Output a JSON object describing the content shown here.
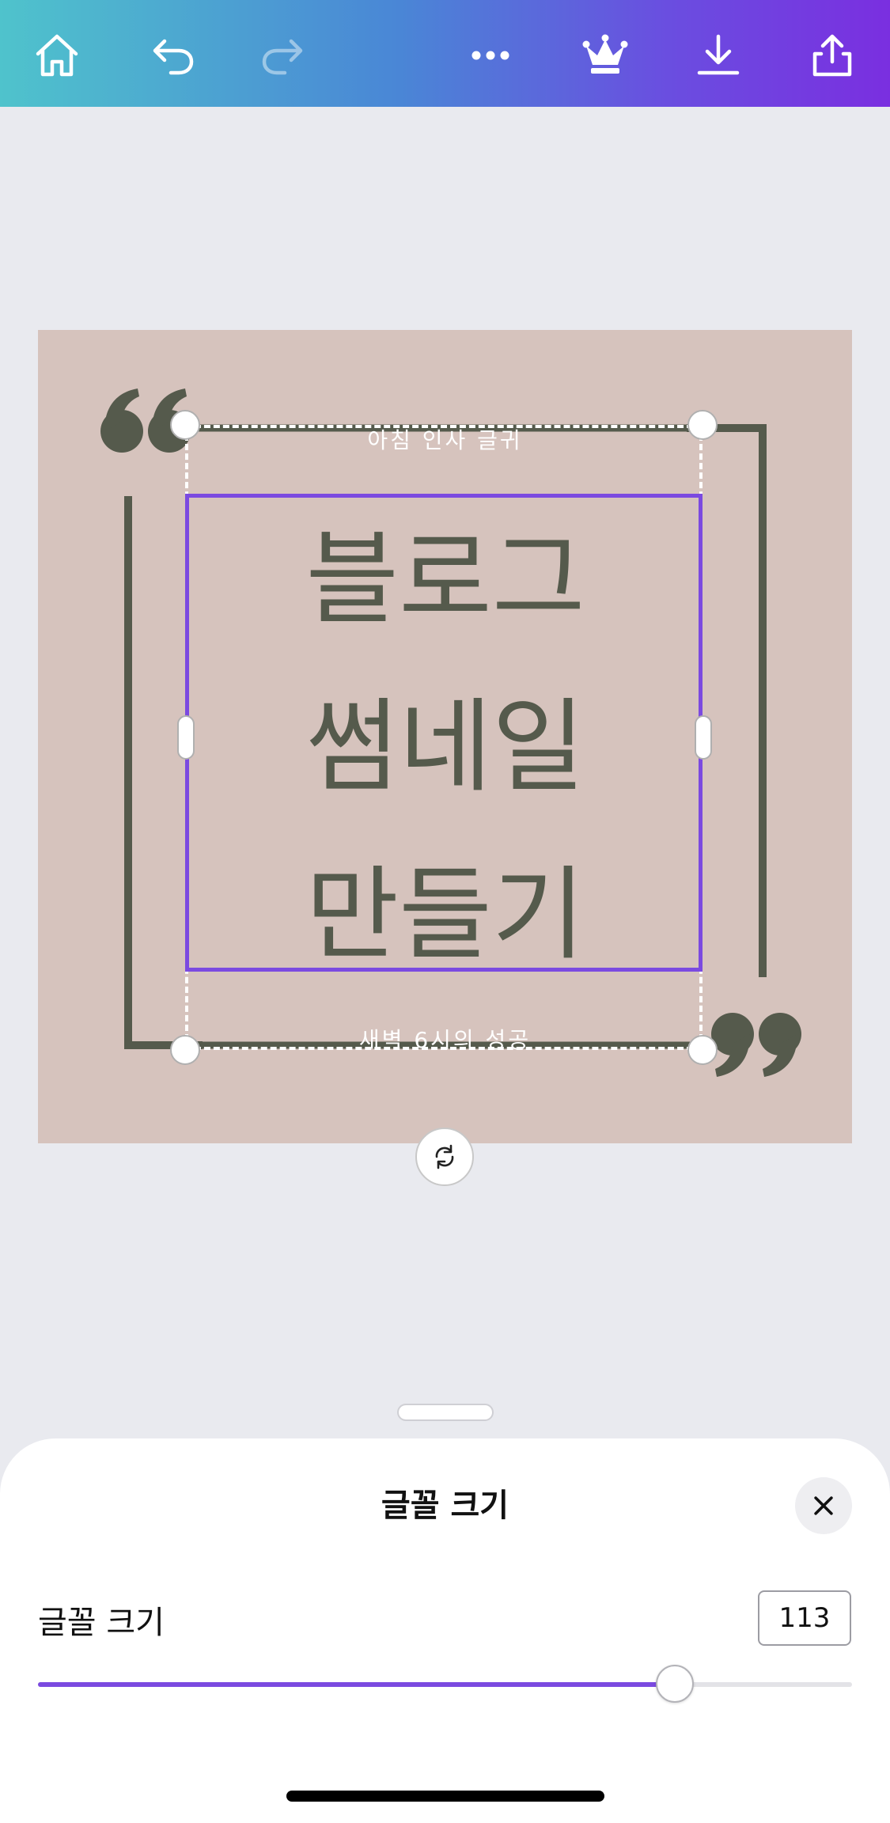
{
  "toolbar": {
    "icons": [
      "home-icon",
      "undo-icon",
      "redo-icon",
      "more-icon",
      "crown-icon",
      "download-icon",
      "share-icon"
    ]
  },
  "canvas": {
    "small_top": "아침 인사 글귀",
    "big_line1": "블로그",
    "big_line2": "썸네일",
    "big_line3": "만들기",
    "small_bottom": "새벽 6시의 성공",
    "background_color": "#d6c3bd",
    "accent_color": "#555a4c"
  },
  "sheet": {
    "title": "글꼴 크기",
    "font_size_label": "글꼴 크기",
    "font_size_value": "113",
    "slider_fraction": 0.782,
    "accent_color": "#7b4ae0"
  }
}
